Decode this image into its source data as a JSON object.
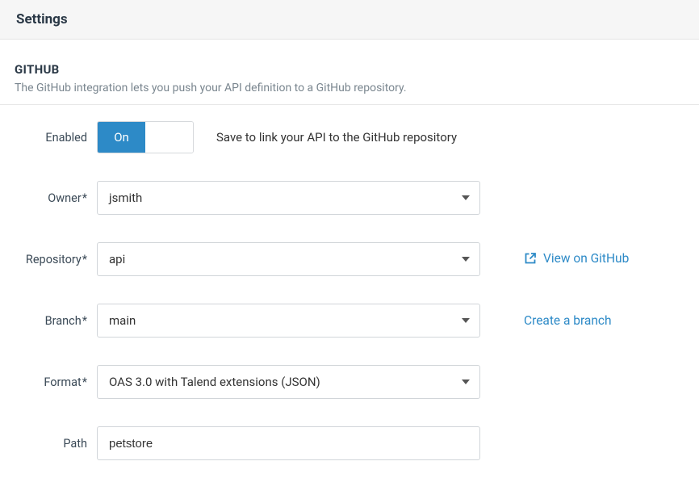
{
  "header": {
    "title": "Settings"
  },
  "section": {
    "title": "GITHUB",
    "description": "The GitHub integration lets you push your API definition to a GitHub repository."
  },
  "form": {
    "enabled": {
      "label": "Enabled",
      "on_text": "On",
      "off_text": "",
      "hint": "Save to link your API to the GitHub repository"
    },
    "owner": {
      "label": "Owner",
      "value": "jsmith"
    },
    "repository": {
      "label": "Repository",
      "value": "api"
    },
    "branch": {
      "label": "Branch",
      "value": "main"
    },
    "format": {
      "label": "Format",
      "value": "OAS 3.0 with Talend extensions (JSON)"
    },
    "path": {
      "label": "Path",
      "value": "petstore"
    },
    "required_marker": "*"
  },
  "links": {
    "view_on_github": "View on GitHub",
    "create_branch": "Create a branch"
  }
}
